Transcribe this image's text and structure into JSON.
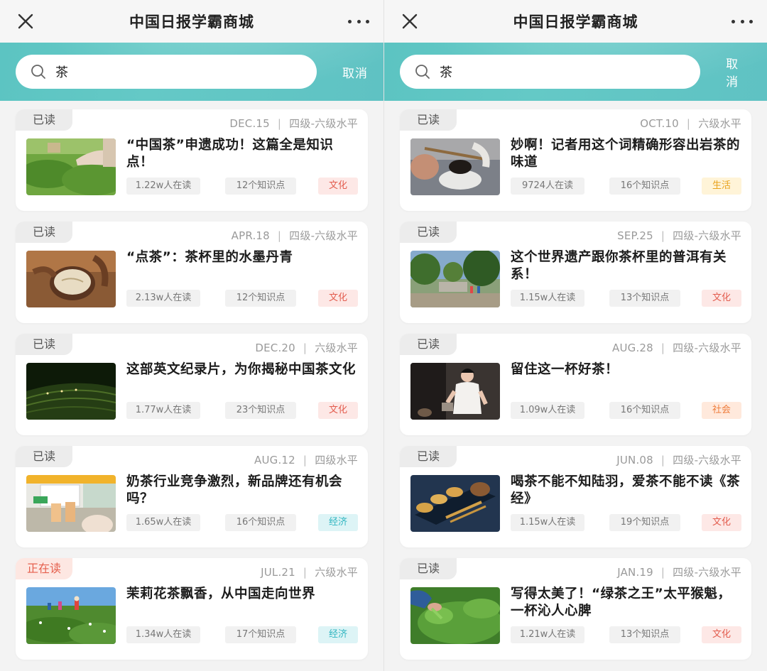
{
  "screens": [
    {
      "title": "中国日报学霸商城",
      "search": {
        "value": "茶",
        "cancel": "取消"
      },
      "cards": [
        {
          "badge": "已读",
          "date": "DEC.15",
          "level": "四级-六级水平",
          "title": "“中国茶”申遗成功！这篇全是知识点！",
          "readers": "1.22w人在读",
          "points": "12个知识点",
          "tag": "文化",
          "tag_type": "culture",
          "image": "tea-field-picking"
        },
        {
          "badge": "已读",
          "date": "APR.18",
          "level": "四级-六级水平",
          "title": "“点茶”：茶杯里的水墨丹青",
          "readers": "2.13w人在读",
          "points": "12个知识点",
          "tag": "文化",
          "tag_type": "culture",
          "image": "tea-bowl"
        },
        {
          "badge": "已读",
          "date": "DEC.20",
          "level": "六级水平",
          "title": "这部英文纪录片，为你揭秘中国茶文化",
          "readers": "1.77w人在读",
          "points": "23个知识点",
          "tag": "文化",
          "tag_type": "culture",
          "image": "night-tea-terrace"
        },
        {
          "badge": "已读",
          "date": "AUG.12",
          "level": "四级水平",
          "title": "奶茶行业竞争激烈，新品牌还有机会吗？",
          "readers": "1.65w人在读",
          "points": "16个知识点",
          "tag": "经济",
          "tag_type": "economy",
          "image": "milk-tea-shop"
        },
        {
          "badge": "正在读",
          "date": "JUL.21",
          "level": "六级水平",
          "title": "茉莉花茶飘香，从中国走向世界",
          "readers": "1.34w人在读",
          "points": "17个知识点",
          "tag": "经济",
          "tag_type": "economy",
          "image": "jasmine-field"
        }
      ]
    },
    {
      "title": "中国日报学霸商城",
      "search": {
        "value": "茶",
        "cancel": "取消"
      },
      "cards": [
        {
          "badge": "已读",
          "date": "OCT.10",
          "level": "六级水平",
          "title": "妙啊！记者用这个词精确形容出岩茶的味道",
          "readers": "9724人在读",
          "points": "16个知识点",
          "tag": "生活",
          "tag_type": "life",
          "image": "tea-leaves-spoon"
        },
        {
          "badge": "已读",
          "date": "SEP.25",
          "level": "四级-六级水平",
          "title": "这个世界遗产跟你茶杯里的普洱有关系！",
          "readers": "1.15w人在读",
          "points": "13个知识点",
          "tag": "文化",
          "tag_type": "culture",
          "image": "heritage-forest"
        },
        {
          "badge": "已读",
          "date": "AUG.28",
          "level": "四级-六级水平",
          "title": "留住这一杯好茶！",
          "readers": "1.09w人在读",
          "points": "16个知识点",
          "tag": "社会",
          "tag_type": "society",
          "image": "tea-artist"
        },
        {
          "badge": "已读",
          "date": "JUN.08",
          "level": "四级-六级水平",
          "title": "喝茶不能不知陆羽，爱茶不能不读《茶经》",
          "readers": "1.15w人在读",
          "points": "19个知识点",
          "tag": "文化",
          "tag_type": "culture",
          "image": "tea-set"
        },
        {
          "badge": "已读",
          "date": "JAN.19",
          "level": "四级-六级水平",
          "title": "写得太美了！“绿茶之王”太平猴魁，一杯沁人心脾",
          "readers": "1.21w人在读",
          "points": "13个知识点",
          "tag": "文化",
          "tag_type": "culture",
          "image": "green-tea-hand"
        }
      ]
    }
  ]
}
